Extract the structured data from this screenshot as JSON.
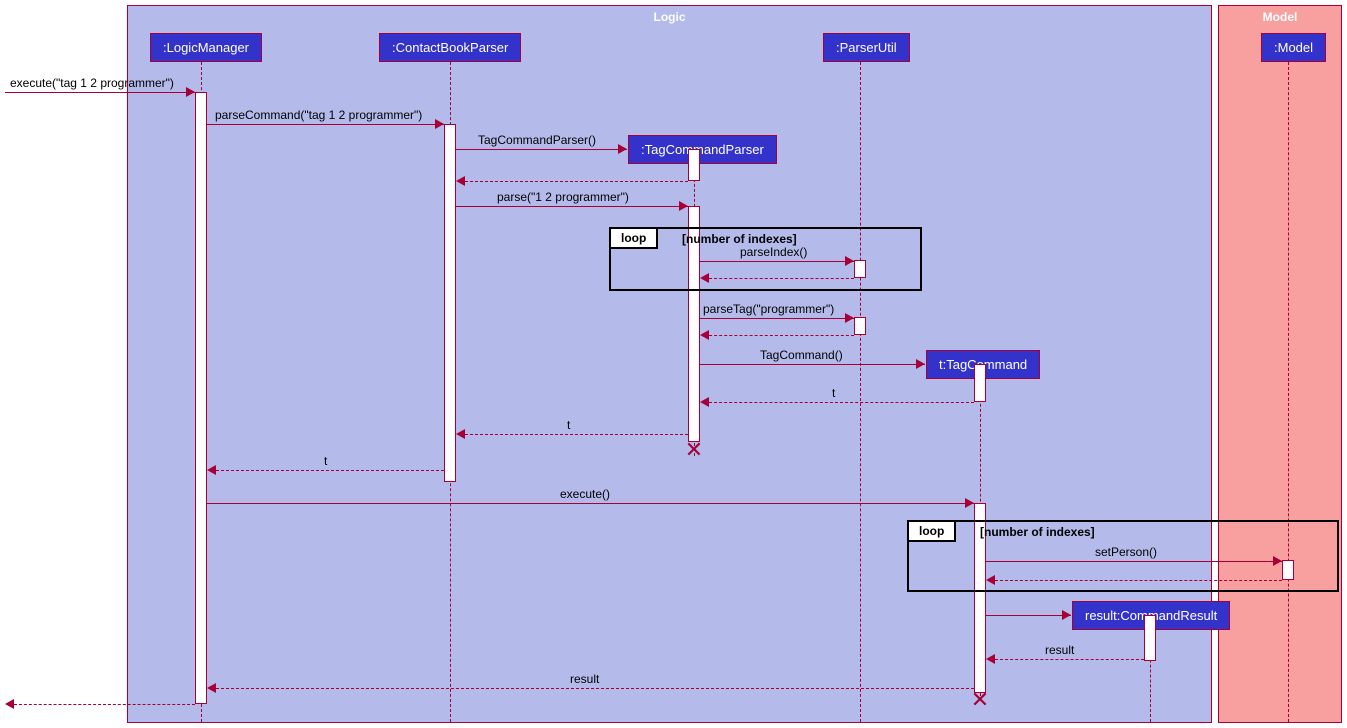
{
  "boxes": {
    "logic": "Logic",
    "model": "Model"
  },
  "participants": {
    "logicManager": ":LogicManager",
    "contactBookParser": ":ContactBookParser",
    "tagCommandParser": ":TagCommandParser",
    "parserUtil": ":ParserUtil",
    "tagCommand": "t:TagCommand",
    "commandResult": "result:CommandResult",
    "model": ":Model"
  },
  "messages": {
    "execEntry": "execute(\"tag 1 2 programmer\")",
    "parseCommand": "parseCommand(\"tag 1 2 programmer\")",
    "tagCommandParserCtor": "TagCommandParser()",
    "parse": "parse(\"1 2 programmer\")",
    "parseIndex": "parseIndex()",
    "parseTag": "parseTag(\"programmer\")",
    "tagCommandCtor": "TagCommand()",
    "retT1": "t",
    "retT2": "t",
    "retT3": "t",
    "executeCall": "execute()",
    "setPerson": "setPerson()",
    "retResult1": "result",
    "retResult2": "result"
  },
  "loops": {
    "label": "loop",
    "cond": "[number of indexes]"
  }
}
